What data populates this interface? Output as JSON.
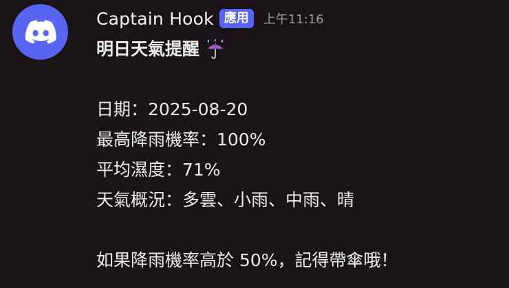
{
  "message": {
    "author": "Captain Hook",
    "app_tag": "應用",
    "timestamp": "上午11:16",
    "avatar_icon": "discord-logo-icon",
    "title": "明日天氣提醒",
    "title_icon": "umbrella-with-rain-icon",
    "lines": [
      "日期：2025-08-20",
      "最高降雨機率：100%",
      "平均濕度：71%",
      "天氣概況：多雲、小雨、中雨、晴"
    ],
    "footer": "如果降雨機率高於 50%，記得帶傘哦！"
  },
  "colors": {
    "background": "#1a1416",
    "brand": "#5865f2",
    "text": "#ececef",
    "muted": "#9a9aa2"
  }
}
